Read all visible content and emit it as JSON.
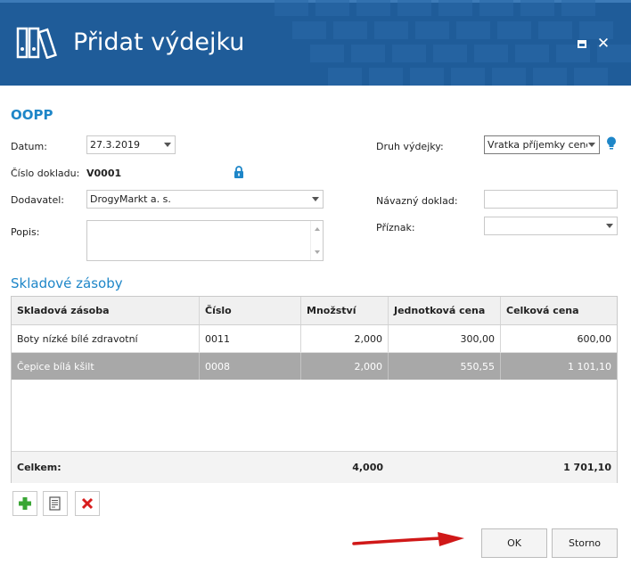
{
  "window": {
    "title": "Přidat výdejku",
    "accent": "#1f5c99"
  },
  "form": {
    "section": "OOPP",
    "datum_label": "Datum:",
    "datum_value": "27.3.2019",
    "cislo_label": "Číslo dokladu:",
    "cislo_value": "V0001",
    "dodavatel_label": "Dodavatel:",
    "dodavatel_value": "DrogyMarkt a. s.",
    "popis_label": "Popis:",
    "druh_label": "Druh výdejky:",
    "druh_value": "Vratka příjemky cenou",
    "navazny_label": "Návazný doklad:",
    "navazny_value": "",
    "priznak_label": "Příznak:",
    "priznak_value": ""
  },
  "grid": {
    "title": "Skladové zásoby",
    "columns": [
      "Skladová zásoba",
      "Číslo",
      "Množství",
      "Jednotková cena",
      "Celková cena"
    ],
    "rows": [
      {
        "zasoba": "Boty nízké bílé zdravotní",
        "cislo": "0011",
        "mnozstvi": "2,000",
        "jedn_cena": "300,00",
        "celk_cena": "600,00"
      },
      {
        "zasoba": "Čepice bílá kšilt",
        "cislo": "0008",
        "mnozstvi": "2,000",
        "jedn_cena": "550,55",
        "celk_cena": "1 101,10"
      }
    ],
    "footer": {
      "label": "Celkem:",
      "mnozstvi": "4,000",
      "celk_cena": "1 701,10"
    }
  },
  "buttons": {
    "ok": "OK",
    "storno": "Storno"
  },
  "icons": [
    "binders-icon",
    "maximize-icon",
    "close-icon",
    "lock-icon",
    "lightbulb-icon",
    "add-icon",
    "edit-icon",
    "delete-icon",
    "red-arrow"
  ]
}
